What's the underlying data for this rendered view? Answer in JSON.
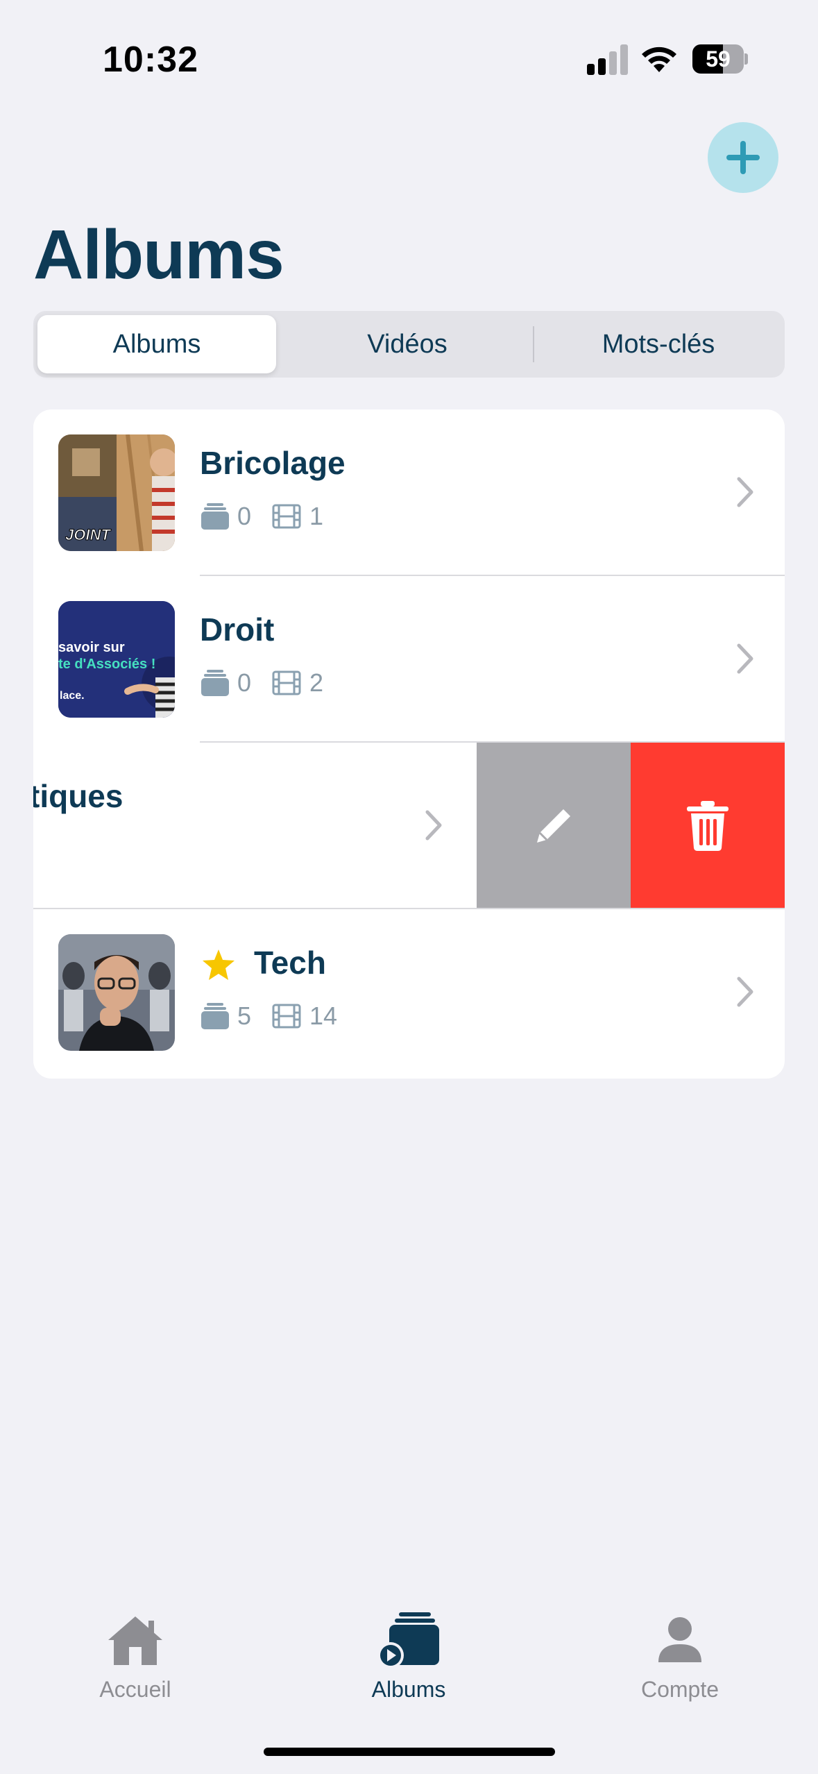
{
  "status_bar": {
    "time": "10:32",
    "battery_percent": "59",
    "battery_level": 0.59,
    "signal_bars_active": 2,
    "signal_bars_total": 4
  },
  "header": {
    "title": "Albums",
    "add_icon": "plus-icon"
  },
  "segmented": {
    "items": [
      "Albums",
      "Vidéos",
      "Mots-clés"
    ],
    "selected": "Albums"
  },
  "albums": [
    {
      "name": "Bricolage",
      "playlists": "0",
      "videos": "1",
      "favorite": false,
      "thumb_text": "JOINT"
    },
    {
      "name": "Droit",
      "playlists": "0",
      "videos": "2",
      "favorite": false,
      "thumb_text_1": "savoir sur",
      "thumb_text_2": "te d'Associés !",
      "thumb_text_3": "lace."
    },
    {
      "name": "tiques",
      "swiped": true,
      "actions": [
        "edit-icon",
        "trash-icon"
      ]
    },
    {
      "name": "Tech",
      "playlists": "5",
      "videos": "14",
      "favorite": true
    }
  ],
  "tabbar": {
    "items": [
      {
        "label": "Accueil",
        "icon": "home-icon"
      },
      {
        "label": "Albums",
        "icon": "albums-icon"
      },
      {
        "label": "Compte",
        "icon": "person-icon"
      }
    ],
    "selected": "Albums"
  },
  "colors": {
    "primary": "#0e3a55",
    "accent": "#2e9bb5",
    "accent_bg": "#b5e2ec",
    "delete": "#ff3b30",
    "edit": "#aaaaae",
    "star": "#f7c600",
    "muted": "#8a9aa6"
  }
}
